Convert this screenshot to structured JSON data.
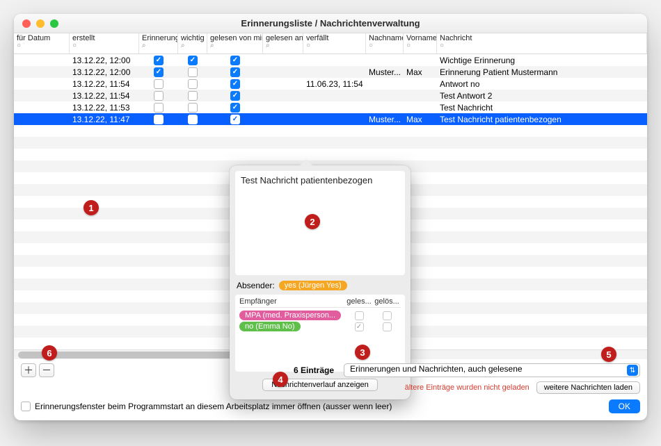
{
  "window": {
    "title": "Erinnerungsliste / Nachrichtenverwaltung"
  },
  "columns": {
    "fuer": "für Datum",
    "erstellt": "erstellt",
    "erinnerung": "Erinnerung",
    "wichtig": "wichtig",
    "glm": "gelesen von mir",
    "gla": "gelesen an...",
    "verfaellt": "verfällt",
    "nachname": "Nachname",
    "vorname": "Vorname",
    "nachricht": "Nachricht"
  },
  "rows": [
    {
      "erstellt": "13.12.22, 12:00",
      "erin": true,
      "wichtig": true,
      "glm": true,
      "verf": "",
      "nach": "",
      "vor": "",
      "msg": "Wichtige Erinnerung"
    },
    {
      "erstellt": "13.12.22, 12:00",
      "erin": true,
      "wichtig": false,
      "glm": true,
      "verf": "",
      "nach": "Muster...",
      "vor": "Max",
      "msg": "Erinnerung Patient Mustermann"
    },
    {
      "erstellt": "13.12.22, 11:54",
      "erin": false,
      "wichtig": false,
      "glm": true,
      "verf": "11.06.23, 11:54",
      "nach": "",
      "vor": "",
      "msg": "Antwort no"
    },
    {
      "erstellt": "13.12.22, 11:54",
      "erin": false,
      "wichtig": false,
      "glm": true,
      "verf": "",
      "nach": "",
      "vor": "",
      "msg": "Test Antwort 2"
    },
    {
      "erstellt": "13.12.22, 11:53",
      "erin": false,
      "wichtig": false,
      "glm": true,
      "verf": "",
      "nach": "",
      "vor": "",
      "msg": "Test Nachricht"
    },
    {
      "erstellt": "13.12.22, 11:47",
      "erin": false,
      "wichtig": false,
      "glm": true,
      "verf": "",
      "nach": "Muster...",
      "vor": "Max",
      "msg": "Test Nachricht patientenbezogen",
      "selected": true
    }
  ],
  "popover": {
    "text": "Test Nachricht patientenbezogen",
    "sender_label": "Absender:",
    "sender_tag": "yes (Jürgen Yes)",
    "recip_header": {
      "c1": "Empfänger",
      "c2": "geles...",
      "c3": "gelös..."
    },
    "recips": [
      {
        "name": "MPA (med. Praxisperson...",
        "color": "pink",
        "read": false
      },
      {
        "name": "no (Emma No)",
        "color": "green",
        "read": true
      }
    ],
    "button": "Nachrichtenverlauf anzeigen"
  },
  "footer": {
    "count": "6 Einträge",
    "filter": "Erinnerungen und Nachrichten, auch gelesene",
    "red": "ältere Einträge wurden nicht geladen",
    "load_more": "weitere Nachrichten laden",
    "auto_open": "Erinnerungsfenster beim Programmstart an diesem Arbeitsplatz immer öffnen (ausser wenn leer)",
    "ok": "OK"
  },
  "annotations": [
    "1",
    "2",
    "3",
    "4",
    "5",
    "6"
  ]
}
